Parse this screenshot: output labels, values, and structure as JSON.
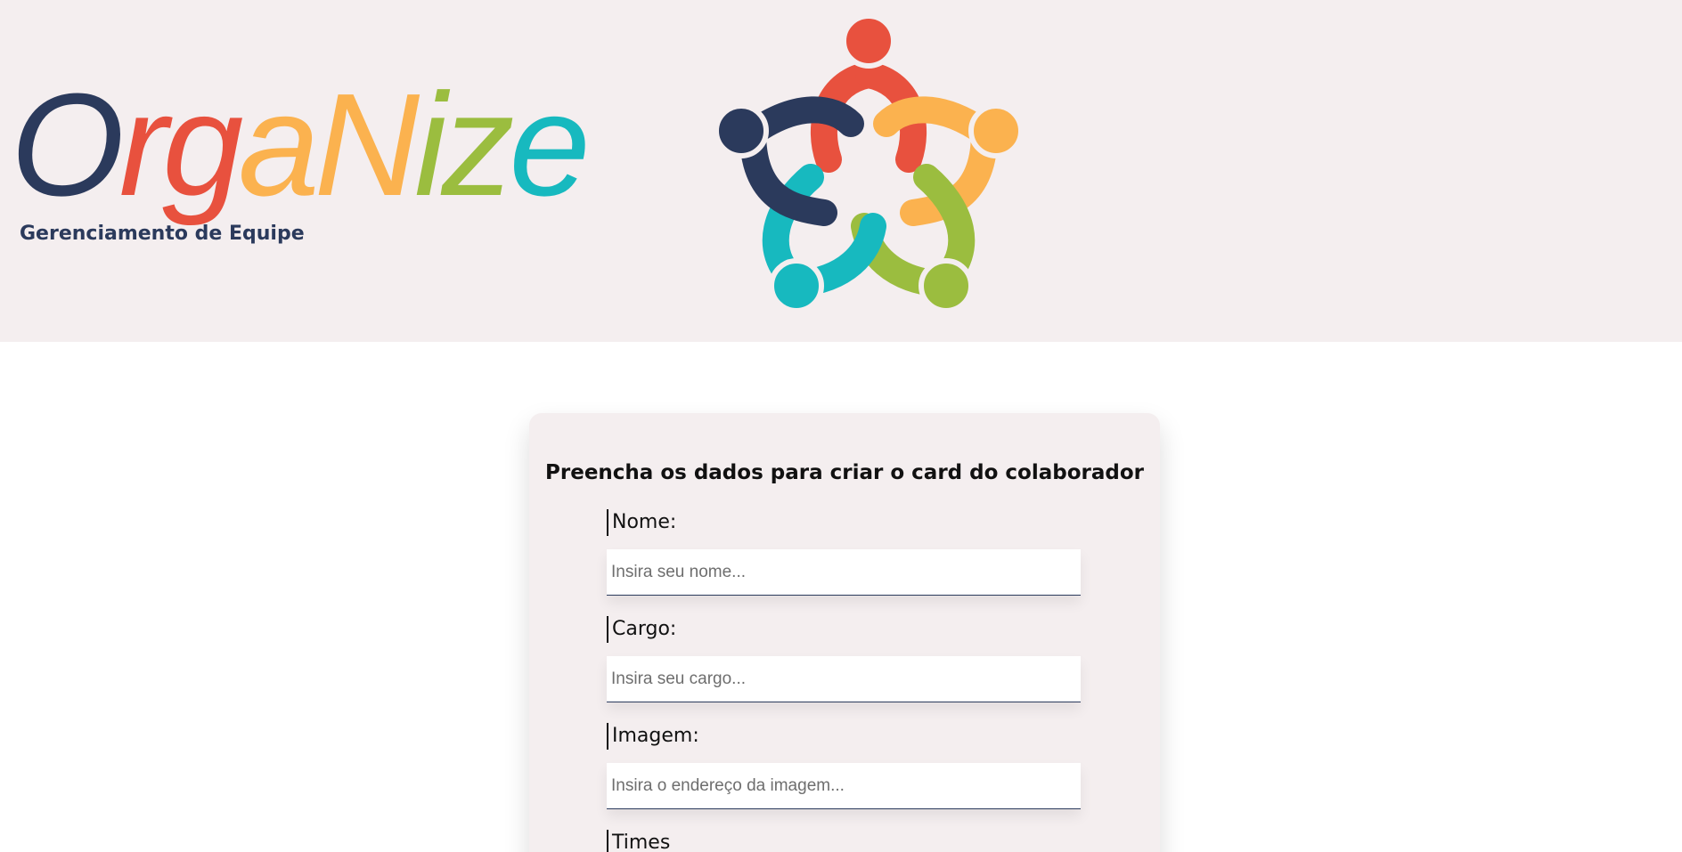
{
  "header": {
    "logo_letters": [
      {
        "char": "O",
        "color": "#2b3a5c"
      },
      {
        "char": "r",
        "color": "#e8513e"
      },
      {
        "char": "g",
        "color": "#e8513e"
      },
      {
        "char": "a",
        "color": "#fbb24f"
      },
      {
        "char": "N",
        "color": "#fbb24f"
      },
      {
        "char": "i",
        "color": "#9bbd3f"
      },
      {
        "char": "z",
        "color": "#9bbd3f"
      },
      {
        "char": "e",
        "color": "#17b9bf"
      }
    ],
    "tagline": "Gerenciamento de Equipe",
    "emblem_icon": "team-circle-icon"
  },
  "form": {
    "title": "Preencha os dados para criar o card do colaborador",
    "fields": [
      {
        "label": "Nome:",
        "placeholder": "Insira seu nome..."
      },
      {
        "label": "Cargo:",
        "placeholder": "Insira seu cargo..."
      },
      {
        "label": "Imagem:",
        "placeholder": "Insira o endereço da imagem..."
      },
      {
        "label": "Times"
      }
    ]
  },
  "colors": {
    "header_bg": "#f4eeef",
    "card_bg": "#f4eeef",
    "navy": "#2b3a5c",
    "red": "#e8513e",
    "orange": "#fbb24f",
    "green": "#9bbd3f",
    "teal": "#17b9bf"
  }
}
